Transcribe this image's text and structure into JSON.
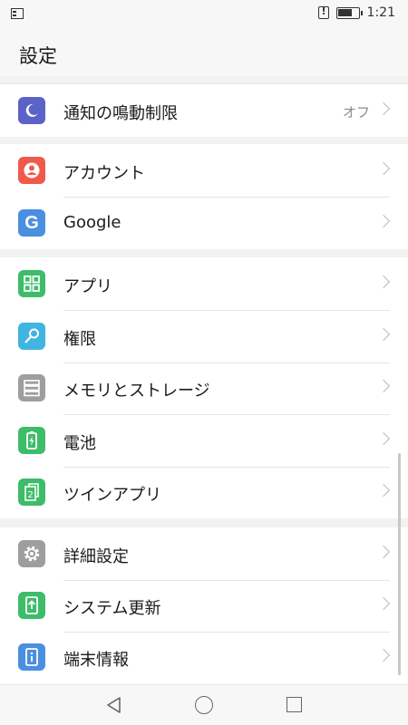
{
  "status_bar": {
    "time": "1:21",
    "battery_level": 0.7
  },
  "app_bar": {
    "title": "設定"
  },
  "sections": [
    {
      "items": [
        {
          "label": "通知の鳴動制限",
          "value": "オフ",
          "icon": "moon-icon",
          "color": "#5b63c9"
        }
      ]
    },
    {
      "items": [
        {
          "label": "アカウント",
          "icon": "account-icon",
          "color": "#f05a4a"
        },
        {
          "label": "Google",
          "icon": "google-icon",
          "color": "#4a8fe0"
        }
      ]
    },
    {
      "items": [
        {
          "label": "アプリ",
          "icon": "apps-grid-icon",
          "color": "#3dbd6a"
        },
        {
          "label": "権限",
          "icon": "key-icon",
          "color": "#3fb5e0"
        },
        {
          "label": "メモリとストレージ",
          "icon": "storage-icon",
          "color": "#9e9e9e"
        },
        {
          "label": "電池",
          "icon": "battery-icon",
          "color": "#3dbd6a"
        },
        {
          "label": "ツインアプリ",
          "icon": "twin-app-icon",
          "color": "#3dbd6a"
        }
      ]
    },
    {
      "items": [
        {
          "label": "詳細設定",
          "icon": "gear-icon",
          "color": "#9e9e9e"
        },
        {
          "label": "システム更新",
          "icon": "system-update-icon",
          "color": "#3dbd6a"
        },
        {
          "label": "端末情報",
          "icon": "info-icon",
          "color": "#4a8fe0"
        }
      ]
    }
  ]
}
